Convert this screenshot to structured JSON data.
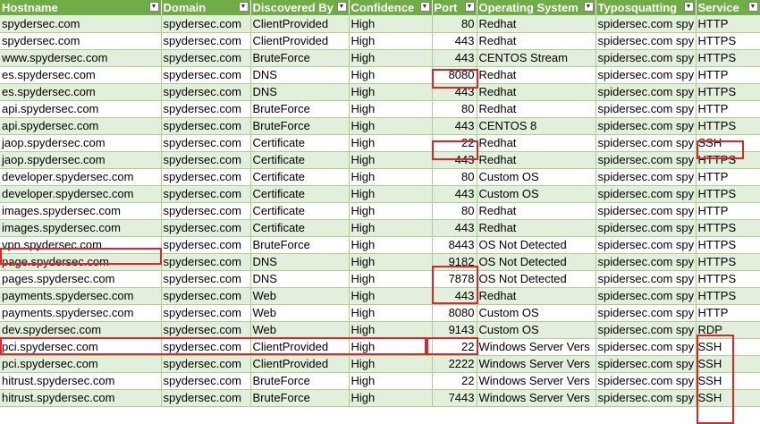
{
  "headers": [
    "Hostname",
    "Domain",
    "Discovered By",
    "Confidence",
    "Port",
    "Operating System",
    "Typosquatting",
    "Service"
  ],
  "filter_icon": "dropdown-arrow-icon",
  "rows": [
    [
      "spydersec.com",
      "spydersec.com",
      "ClientProvided",
      "High",
      "80",
      "Redhat",
      "spidersec.com spy",
      "HTTP"
    ],
    [
      "spydersec.com",
      "spydersec.com",
      "ClientProvided",
      "High",
      "443",
      "Redhat",
      "spidersec.com spy",
      "HTTPS"
    ],
    [
      "www.spydersec.com",
      "spydersec.com",
      "BruteForce",
      "High",
      "443",
      "CENTOS Stream",
      "spidersec.com spy",
      "HTTPS"
    ],
    [
      "es.spydersec.com",
      "spydersec.com",
      "DNS",
      "High",
      "8080",
      "Redhat",
      "spidersec.com spy",
      "HTTP"
    ],
    [
      "es.spydersec.com",
      "spydersec.com",
      "DNS",
      "High",
      "443",
      "Redhat",
      "spidersec.com spy",
      "HTTPS"
    ],
    [
      "api.spydersec.com",
      "spydersec.com",
      "BruteForce",
      "High",
      "80",
      "Redhat",
      "spidersec.com spy",
      "HTTP"
    ],
    [
      "api.spydersec.com",
      "spydersec.com",
      "BruteForce",
      "High",
      "443",
      "CENTOS 8",
      "spidersec.com spy",
      "HTTPS"
    ],
    [
      "jaop.spydersec.com",
      "spydersec.com",
      "Certificate",
      "High",
      "22",
      "Redhat",
      "spidersec.com spy",
      "SSH"
    ],
    [
      "jaop.spydersec.com",
      "spydersec.com",
      "Certificate",
      "High",
      "443",
      "Redhat",
      "spidersec.com spy",
      "HTTPS"
    ],
    [
      "developer.spydersec.com",
      "spydersec.com",
      "Certificate",
      "High",
      "80",
      "Custom OS",
      "spidersec.com spy",
      "HTTP"
    ],
    [
      "developer.spydersec.com",
      "spydersec.com",
      "Certificate",
      "High",
      "443",
      "Custom OS",
      "spidersec.com spy",
      "HTTPS"
    ],
    [
      "images.spydersec.com",
      "spydersec.com",
      "Certificate",
      "High",
      "80",
      "Redhat",
      "spidersec.com spy",
      "HTTP"
    ],
    [
      "images.spydersec.com",
      "spydersec.com",
      "Certificate",
      "High",
      "443",
      "Redhat",
      "spidersec.com spy",
      "HTTPS"
    ],
    [
      "vpn.spydersec.com",
      "spydersec.com",
      "BruteForce",
      "High",
      "8443",
      "OS Not Detected",
      "spidersec.com spy",
      "HTTPS"
    ],
    [
      "page.spydersec.com",
      "spydersec.com",
      "DNS",
      "High",
      "9182",
      "OS Not Detected",
      "spidersec.com spy",
      "HTTPS"
    ],
    [
      "pages.spydersec.com",
      "spydersec.com",
      "DNS",
      "High",
      "7878",
      "OS Not Detected",
      "spidersec.com spy",
      "HTTPS"
    ],
    [
      "payments.spydersec.com",
      "spydersec.com",
      "Web",
      "High",
      "443",
      "Redhat",
      "spidersec.com spy",
      "HTTPS"
    ],
    [
      "payments.spydersec.com",
      "spydersec.com",
      "Web",
      "High",
      "8080",
      "Custom OS",
      "spidersec.com spy",
      "HTTP"
    ],
    [
      "dev.spydersec.com",
      "spydersec.com",
      "Web",
      "High",
      "9143",
      "Custom OS",
      "spidersec.com spy",
      "RDP"
    ],
    [
      "pci.spydersec.com",
      "spydersec.com",
      "ClientProvided",
      "High",
      "22",
      "Windows Server Vers",
      "spidersec.com spy",
      "SSH"
    ],
    [
      "pci.spydersec.com",
      "spydersec.com",
      "ClientProvided",
      "High",
      "2222",
      "Windows Server Vers",
      "spidersec.com spy",
      "SSH"
    ],
    [
      "hitrust.spydersec.com",
      "spydersec.com",
      "BruteForce",
      "High",
      "22",
      "Windows Server Vers",
      "spidersec.com spy",
      "SSH"
    ],
    [
      "hitrust.spydersec.com",
      "spydersec.com",
      "BruteForce",
      "High",
      "7443",
      "Windows Server Vers",
      "spidersec.com spy",
      "SSH"
    ]
  ],
  "colors": {
    "header": "#70ad47",
    "band": "#e2efda",
    "highlight": "#e0242b"
  }
}
